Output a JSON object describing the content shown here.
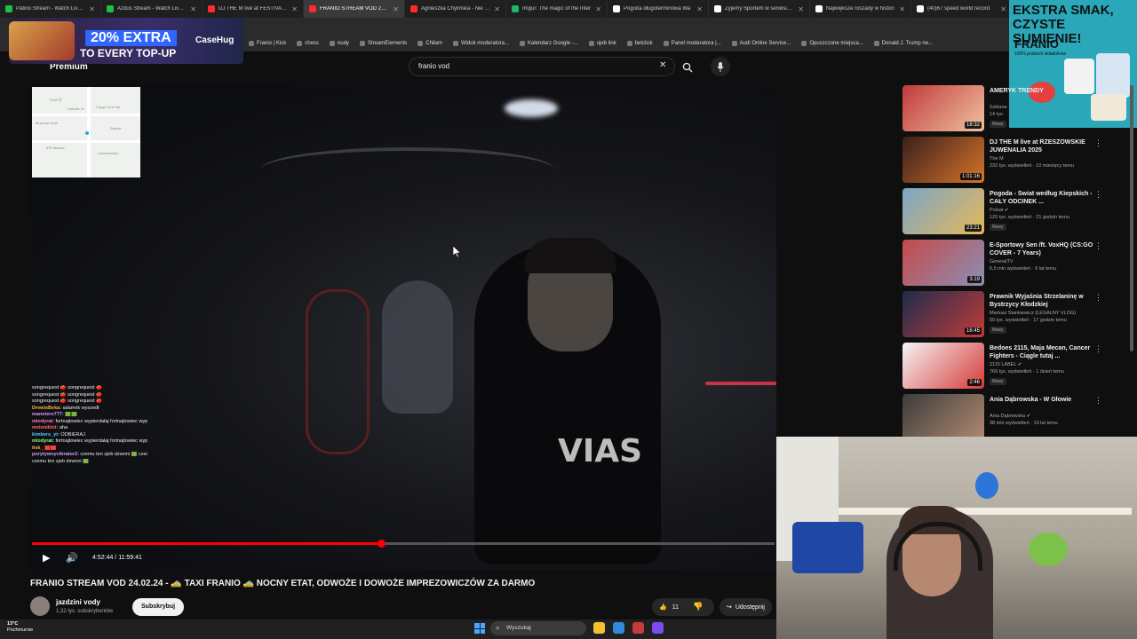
{
  "browser": {
    "tabs": [
      {
        "label": "Patino Stream - Watch Live on",
        "active": false,
        "fav": "#1fbf4a"
      },
      {
        "label": "Azdus Stream - Watch Live on",
        "active": false,
        "fav": "#1fbf4a"
      },
      {
        "label": "DJ THE M live at FESTIVALAN",
        "active": false,
        "fav": "#ff2b2b"
      },
      {
        "label": "FRANIO STREAM VOD 24.02.2",
        "active": true,
        "fav": "#ff2b2b"
      },
      {
        "label": "Agnieszka Chylińska - Nie mó",
        "active": false,
        "fav": "#ff2b2b"
      },
      {
        "label": "Imgur: The magic of the Inter",
        "active": false,
        "fav": "#1bb76e"
      },
      {
        "label": "Pogoda długoterminowa Wa",
        "active": false,
        "fav": "#ffffff"
      },
      {
        "label": "Żyjemy Sportem w serwisie X",
        "active": false,
        "fav": "#ffffff"
      },
      {
        "label": "Największe roszady w histori",
        "active": false,
        "fav": "#ffffff"
      },
      {
        "label": "(40)67 speed world record",
        "active": false,
        "fav": "#ffffff"
      }
    ],
    "bookmarks": [
      "Franio | Kick",
      "chess",
      "nudy",
      "StreamElements",
      "Chiłam",
      "Widok moderatora...",
      "Kalendarz Google -...",
      "ujeb link",
      "betclick",
      "Panel moderatora |...",
      "Audi Online Service...",
      "Opuszczone miejsca...",
      "Donald J. Trump ne..."
    ]
  },
  "youtube": {
    "premium_label": "Premium",
    "search_value": "franio vod"
  },
  "ads": {
    "left_line1": "20% EXTRA",
    "left_line2": "TO EVERY TOP-UP",
    "left_brand": "CaseHug",
    "right_line1": "EKSTRA SMAK,",
    "right_line1b": "CZYSTE SUMIENIE!",
    "right_brand": "FRANIO",
    "right_sub": "100% polskich składników"
  },
  "video": {
    "time_current": "4:52:44",
    "time_total": "11:59:41",
    "progress": 0.47,
    "shirt_text": "VIAS",
    "minimap": {
      "labels": [
        "Ptolil Ⓑ",
        "Muzeum Huta",
        "Osiedle Ur",
        "Cargo Your Har",
        "Zabrze",
        "Czerniowska",
        "IPD Mokwa"
      ]
    }
  },
  "chat": [
    {
      "user": "",
      "msg": "songrequest 🍅 songrequest 🍅"
    },
    {
      "user": "",
      "msg": "songrequest 🍅 songrequest 🍅"
    },
    {
      "user": "",
      "msg": "songrequest 🍅 songrequest 🍅"
    },
    {
      "user": "DrewixBeka:",
      "msg": "adamek wyszedł"
    },
    {
      "user": "manstero777:",
      "msg": "🟩🟩"
    },
    {
      "user": "mlodyrat:",
      "msg": "fortnajtowiec wypierdalaj fortnajtowiec wypierdalaj fortnajtowiec wypierdalaj fortnajtowiec"
    },
    {
      "user": "meloniktst:",
      "msg": "aha"
    },
    {
      "user": "kimbers_yt:",
      "msg": "ODBIERAJ"
    },
    {
      "user": "mlodyrat:",
      "msg": "fortnajtowiec wypierdalaj fortnajtowiec wypierdalaj fortnajtowiec wypierdalaj fortnajtowiec"
    },
    {
      "user": "tisk_",
      "msg": "🟥🟥"
    },
    {
      "user": "porytywnyvibrator2:",
      "msg": "czemu ten zjeb dzwoni 🟩 czemu ten zjeb dzwoni 🟩 czemu ten zjeb dzwoni"
    },
    {
      "user": "",
      "msg": "czemu ten zjeb dzwoni 🟩"
    }
  ],
  "meta": {
    "title": "FRANIO STREAM VOD 24.02.24 - 🚕 TAXI FRANIO 🚕 NOCNY ETAT, ODWOŻE I DOWOŻE IMPREZOWICZÓW ZA DARMO",
    "channel": "jazdzini vody",
    "subscribers": "1,32 tys. subskrybentów",
    "subscribe_label": "Subskrybuj",
    "likes": "11",
    "share_label": "Udostępnij"
  },
  "recommendations": [
    {
      "title": "AMERYK TRENDY",
      "channel": "Szklana",
      "meta": "14 tys.",
      "new": "Nowy",
      "duration": "18:32",
      "c1": "#c0393b",
      "c2": "#f0c3a1"
    },
    {
      "title": "DJ THE M live at RZESZOWSKIE JUWENALIA 2025",
      "channel": "The M",
      "meta": "232 tys. wyświetleń · 10 miesięcy temu",
      "new": "",
      "duration": "1:01:16",
      "c1": "#3a1f1a",
      "c2": "#d8732a"
    },
    {
      "title": "Pogoda - Świat według Kiepskich - CAŁY ODCINEK ...",
      "channel": "Polsat ✔",
      "meta": "120 tys. wyświetleń · 21 godzin temu",
      "new": "Nowy",
      "duration": "23:21",
      "c1": "#7aa6c8",
      "c2": "#e7b85a"
    },
    {
      "title": "E-Sportowy Sen /ft. VoxHQ (CS:GO COVER - 7 Years)",
      "channel": "GeneralTV",
      "meta": "6,5 mln wyświetleń · 9 lat temu",
      "new": "",
      "duration": "3:19",
      "c1": "#c44a4a",
      "c2": "#8c8fb6"
    },
    {
      "title": "Prawnik Wyjaśnia Strzelaninę w Bystrzycy Kłodzkiej",
      "channel": "Mariusz Stankiewicz (LEGALNY VLOG)",
      "meta": "50 tys. wyświetleń · 17 godzin temu",
      "new": "Nowy",
      "duration": "16:45",
      "c1": "#1d2d4a",
      "c2": "#c33b3b"
    },
    {
      "title": "Bedoes 2115, Maja Mecan, Cancer Fighters - Ciągle tutaj ...",
      "channel": "2115 LABEL ✔",
      "meta": "769 tys. wyświetleń · 1 dzień temu",
      "new": "Nowy",
      "duration": "2:46",
      "c1": "#f4f4f4",
      "c2": "#d83a3a"
    },
    {
      "title": "Ania Dąbrowska - W Głowie",
      "channel": "Ania Dąbrowska ✔",
      "meta": "38 mln wyświetleń · 10 lat temu",
      "new": "",
      "duration": "",
      "c1": "#3c3c3c",
      "c2": "#b08a70"
    }
  ],
  "taskbar": {
    "temperature": "13°C",
    "weather_desc": "Pochmurnie",
    "search_label": "Wyszukaj",
    "icons": [
      "#f2c230",
      "#2f8bd8",
      "#c63b3b",
      "#7a4df0"
    ]
  }
}
